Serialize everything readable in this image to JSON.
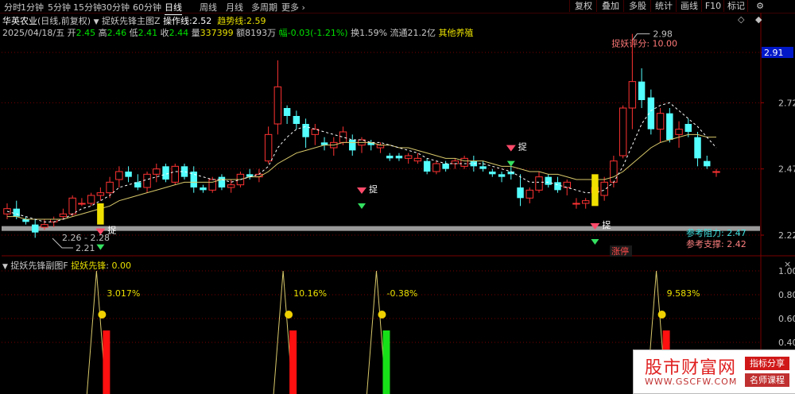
{
  "topbar": {
    "timeframes": [
      "分时",
      "1分钟",
      "5分钟",
      "15分钟",
      "30分钟",
      "60分钟",
      "日线",
      "周线",
      "月线",
      "多周期",
      "更多"
    ],
    "active": "日线",
    "right_buttons": [
      "复权",
      "叠加",
      "多股",
      "统计",
      "画线",
      "F10",
      "标记",
      "⚙"
    ]
  },
  "header": {
    "stock": "华英农业",
    "period": "(日线,前复权)",
    "indicator": "捉妖先锋主图Z",
    "op_label": "操作线:",
    "op_value": "2.52",
    "trend_label": "趋势线:",
    "trend_value": "2.59",
    "date": "2025/04/18/五",
    "open_label": "开",
    "open": "2.45",
    "high_label": "高",
    "high": "2.46",
    "low_label": "低",
    "low": "2.41",
    "close_label": "收",
    "close": "2.44",
    "vol_label": "量",
    "vol": "337399",
    "amt_label": "额",
    "amt": "8193万",
    "chg_label": "幅",
    "chg": "-0.03(-1.21%)",
    "turnover_label": "换",
    "turnover": "1.59%",
    "float_label": "流通",
    "float": "21.2亿",
    "sector": "其他养殖"
  },
  "main_axis": {
    "labels": [
      "2.91",
      "2.72",
      "2.47",
      "2.22"
    ],
    "current": "2.91"
  },
  "annotations": {
    "high_marker": "2.98",
    "score": "捉妖评分: 10.00",
    "low_range": "2.26 - 2.28",
    "low_marker": "2.21",
    "resistance": "参考阻力: 2.47",
    "support": "参考支撑: 2.42",
    "tag": "涨停",
    "signal_char": "捉"
  },
  "sub": {
    "title": "捉妖先锋副图F",
    "name": "捉妖先锋",
    "value": "0.00",
    "axis": [
      "1.00",
      "0.80",
      "0.60",
      "0.40"
    ],
    "pcts": [
      "3.017%",
      "10.16%",
      "-0.38%",
      "9.583%"
    ]
  },
  "watermark": {
    "title": "股市财富网",
    "url": "WWW.GSCFW.COM",
    "badge1": "指标分享",
    "badge2": "名师课程"
  },
  "colors": {
    "up": "#ff3232",
    "down": "#54ffff",
    "ma5": "#ffffff",
    "ma20": "#d8c86a",
    "grid": "#7a0000"
  },
  "chart_data": [
    {
      "type": "candlestick",
      "title": "华英农业 (日线,前复权)",
      "ylim": [
        2.2,
        3.0
      ],
      "y_ticks": [
        2.22,
        2.47,
        2.72,
        2.91
      ],
      "ohlc": [
        [
          2.3,
          2.34,
          2.28,
          2.32
        ],
        [
          2.32,
          2.35,
          2.28,
          2.29
        ],
        [
          2.28,
          2.29,
          2.26,
          2.27
        ],
        [
          2.26,
          2.28,
          2.21,
          2.23
        ],
        [
          2.25,
          2.28,
          2.24,
          2.26
        ],
        [
          2.27,
          2.29,
          2.25,
          2.28
        ],
        [
          2.29,
          2.32,
          2.28,
          2.3
        ],
        [
          2.3,
          2.37,
          2.29,
          2.36
        ],
        [
          2.34,
          2.36,
          2.33,
          2.34
        ],
        [
          2.34,
          2.38,
          2.33,
          2.37
        ],
        [
          2.37,
          2.4,
          2.35,
          2.38
        ],
        [
          2.38,
          2.44,
          2.36,
          2.42
        ],
        [
          2.43,
          2.48,
          2.4,
          2.46
        ],
        [
          2.46,
          2.48,
          2.42,
          2.44
        ],
        [
          2.42,
          2.45,
          2.39,
          2.4
        ],
        [
          2.4,
          2.46,
          2.38,
          2.45
        ],
        [
          2.45,
          2.49,
          2.42,
          2.47
        ],
        [
          2.48,
          2.49,
          2.42,
          2.43
        ],
        [
          2.42,
          2.49,
          2.41,
          2.48
        ],
        [
          2.48,
          2.49,
          2.43,
          2.44
        ],
        [
          2.46,
          2.48,
          2.38,
          2.4
        ],
        [
          2.4,
          2.41,
          2.38,
          2.39
        ],
        [
          2.39,
          2.44,
          2.38,
          2.43
        ],
        [
          2.44,
          2.45,
          2.39,
          2.4
        ],
        [
          2.4,
          2.43,
          2.38,
          2.41
        ],
        [
          2.41,
          2.46,
          2.4,
          2.45
        ],
        [
          2.45,
          2.47,
          2.43,
          2.44
        ],
        [
          2.44,
          2.47,
          2.42,
          2.45
        ],
        [
          2.5,
          2.63,
          2.49,
          2.6
        ],
        [
          2.64,
          2.88,
          2.6,
          2.78
        ],
        [
          2.7,
          2.71,
          2.64,
          2.67
        ],
        [
          2.67,
          2.69,
          2.62,
          2.64
        ],
        [
          2.64,
          2.66,
          2.55,
          2.59
        ],
        [
          2.6,
          2.64,
          2.56,
          2.62
        ],
        [
          2.57,
          2.59,
          2.54,
          2.56
        ],
        [
          2.55,
          2.59,
          2.52,
          2.57
        ],
        [
          2.57,
          2.63,
          2.56,
          2.61
        ],
        [
          2.58,
          2.6,
          2.52,
          2.54
        ],
        [
          2.56,
          2.59,
          2.53,
          2.58
        ],
        [
          2.57,
          2.58,
          2.54,
          2.56
        ],
        [
          2.55,
          2.57,
          2.53,
          2.56
        ],
        [
          2.52,
          2.53,
          2.5,
          2.51
        ],
        [
          2.52,
          2.53,
          2.5,
          2.51
        ],
        [
          2.51,
          2.53,
          2.49,
          2.52
        ],
        [
          2.5,
          2.53,
          2.49,
          2.51
        ],
        [
          2.5,
          2.51,
          2.45,
          2.46
        ],
        [
          2.46,
          2.5,
          2.45,
          2.49
        ],
        [
          2.49,
          2.5,
          2.46,
          2.47
        ],
        [
          2.49,
          2.51,
          2.47,
          2.5
        ],
        [
          2.48,
          2.52,
          2.47,
          2.51
        ],
        [
          2.5,
          2.52,
          2.46,
          2.48
        ],
        [
          2.48,
          2.5,
          2.46,
          2.47
        ],
        [
          2.46,
          2.47,
          2.44,
          2.45
        ],
        [
          2.45,
          2.46,
          2.42,
          2.44
        ],
        [
          2.46,
          2.48,
          2.43,
          2.45
        ],
        [
          2.4,
          2.45,
          2.33,
          2.36
        ],
        [
          2.36,
          2.4,
          2.34,
          2.39
        ],
        [
          2.39,
          2.46,
          2.38,
          2.44
        ],
        [
          2.44,
          2.45,
          2.4,
          2.41
        ],
        [
          2.42,
          2.44,
          2.38,
          2.39
        ],
        [
          2.4,
          2.43,
          2.37,
          2.42
        ],
        [
          2.34,
          2.36,
          2.32,
          2.34
        ],
        [
          2.34,
          2.36,
          2.32,
          2.35
        ],
        [
          2.38,
          2.41,
          2.37,
          2.4
        ],
        [
          2.37,
          2.44,
          2.35,
          2.42
        ],
        [
          2.42,
          2.52,
          2.4,
          2.5
        ],
        [
          2.52,
          2.71,
          2.51,
          2.7
        ],
        [
          2.7,
          2.98,
          2.62,
          2.8
        ],
        [
          2.8,
          2.85,
          2.7,
          2.73
        ],
        [
          2.74,
          2.77,
          2.6,
          2.62
        ],
        [
          2.62,
          2.7,
          2.57,
          2.68
        ],
        [
          2.68,
          2.7,
          2.57,
          2.58
        ],
        [
          2.6,
          2.65,
          2.55,
          2.62
        ],
        [
          2.64,
          2.66,
          2.59,
          2.61
        ],
        [
          2.59,
          2.61,
          2.48,
          2.51
        ],
        [
          2.5,
          2.52,
          2.47,
          2.48
        ],
        [
          2.46,
          2.47,
          2.44,
          2.46
        ]
      ],
      "series": [
        {
          "name": "操作线",
          "values": [
            2.31,
            2.3,
            2.29,
            2.28,
            2.27,
            2.27,
            2.28,
            2.3,
            2.32,
            2.33,
            2.35,
            2.37,
            2.4,
            2.41,
            2.42,
            2.43,
            2.44,
            2.45,
            2.46,
            2.46,
            2.45,
            2.44,
            2.43,
            2.43,
            2.42,
            2.43,
            2.44,
            2.45,
            2.48,
            2.55,
            2.59,
            2.62,
            2.63,
            2.62,
            2.61,
            2.6,
            2.59,
            2.58,
            2.58,
            2.57,
            2.57,
            2.56,
            2.55,
            2.54,
            2.53,
            2.51,
            2.5,
            2.49,
            2.49,
            2.49,
            2.49,
            2.49,
            2.48,
            2.47,
            2.46,
            2.44,
            2.42,
            2.42,
            2.42,
            2.41,
            2.4,
            2.39,
            2.38,
            2.38,
            2.39,
            2.42,
            2.48,
            2.56,
            2.64,
            2.69,
            2.71,
            2.72,
            2.69,
            2.66,
            2.63,
            2.59,
            2.55
          ]
        },
        {
          "name": "趋势线",
          "values": [
            2.29,
            2.29,
            2.28,
            2.28,
            2.28,
            2.28,
            2.28,
            2.29,
            2.3,
            2.31,
            2.32,
            2.33,
            2.35,
            2.36,
            2.37,
            2.38,
            2.39,
            2.4,
            2.41,
            2.42,
            2.42,
            2.42,
            2.42,
            2.43,
            2.43,
            2.43,
            2.44,
            2.44,
            2.46,
            2.49,
            2.51,
            2.53,
            2.54,
            2.55,
            2.56,
            2.56,
            2.57,
            2.57,
            2.57,
            2.57,
            2.56,
            2.56,
            2.55,
            2.55,
            2.54,
            2.53,
            2.52,
            2.51,
            2.51,
            2.5,
            2.5,
            2.5,
            2.49,
            2.48,
            2.48,
            2.47,
            2.46,
            2.46,
            2.45,
            2.45,
            2.44,
            2.43,
            2.43,
            2.43,
            2.43,
            2.44,
            2.46,
            2.49,
            2.52,
            2.55,
            2.57,
            2.58,
            2.59,
            2.6,
            2.6,
            2.59,
            2.59
          ]
        }
      ]
    },
    {
      "type": "line",
      "title": "捉妖先锋副图F",
      "ylim": [
        0,
        1
      ],
      "y_ticks": [
        0.4,
        0.6,
        0.8,
        1.0
      ],
      "signal_index": [
        5,
        19,
        27,
        48
      ],
      "series": [
        {
          "name": "捉妖先锋",
          "values": []
        }
      ]
    }
  ]
}
